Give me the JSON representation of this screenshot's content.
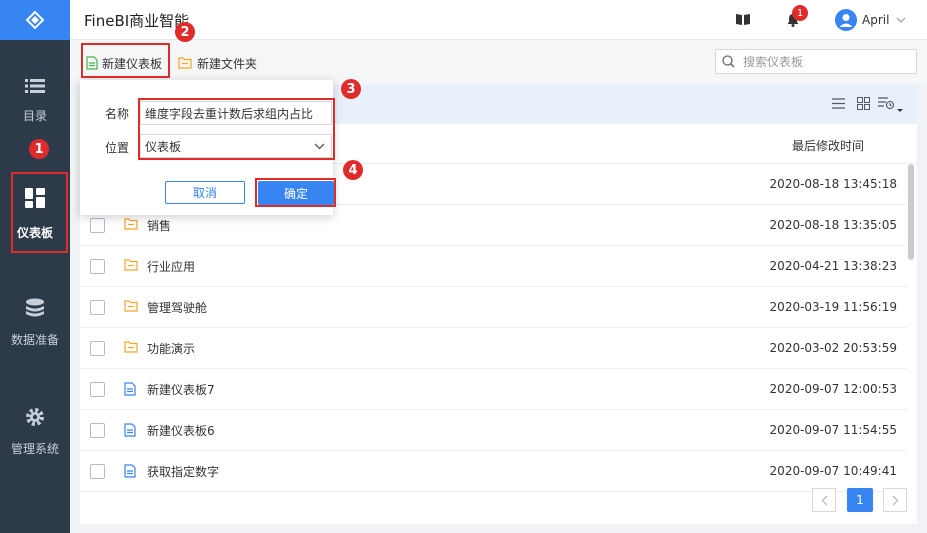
{
  "app": {
    "title": "FineBI商业智能"
  },
  "sidebar": {
    "items": [
      {
        "label": "目录",
        "icon": "list-icon"
      },
      {
        "label": "仪表板",
        "icon": "dashboard-icon"
      },
      {
        "label": "数据准备",
        "icon": "database-icon"
      },
      {
        "label": "管理系统",
        "icon": "gear-icon"
      }
    ]
  },
  "header": {
    "notification_count": "1",
    "user_name": "April"
  },
  "toolbar": {
    "new_dashboard_label": "新建仪表板",
    "new_folder_label": "新建文件夹",
    "search_placeholder": "搜索仪表板"
  },
  "table": {
    "time_header": "最后修改时间",
    "rows": [
      {
        "name": "",
        "type": "folder",
        "time": "2020-08-18 13:45:18"
      },
      {
        "name": "销售",
        "type": "folder",
        "time": "2020-08-18 13:35:05"
      },
      {
        "name": "行业应用",
        "type": "folder",
        "time": "2020-04-21 13:38:23"
      },
      {
        "name": "管理驾驶舱",
        "type": "folder",
        "time": "2020-03-19 11:56:19"
      },
      {
        "name": "功能演示",
        "type": "folder",
        "time": "2020-03-02 20:53:59"
      },
      {
        "name": "新建仪表板7",
        "type": "dashboard",
        "time": "2020-09-07 12:00:53"
      },
      {
        "name": "新建仪表板6",
        "type": "dashboard",
        "time": "2020-09-07 11:54:55"
      },
      {
        "name": "获取指定数字",
        "type": "dashboard",
        "time": "2020-09-07 10:49:41"
      }
    ]
  },
  "pager": {
    "current": "1"
  },
  "dialog": {
    "name_label": "名称",
    "name_value": "维度字段去重计数后求组内占比",
    "location_label": "位置",
    "location_value": "仪表板",
    "cancel_label": "取消",
    "ok_label": "确定"
  },
  "annotations": {
    "step1": "1",
    "step2": "2",
    "step3": "3",
    "step4": "4"
  },
  "colors": {
    "accent": "#3685f2",
    "sidebar_bg": "#2d3a4a",
    "highlight": "#e02b2b",
    "folder": "#f5a623"
  }
}
